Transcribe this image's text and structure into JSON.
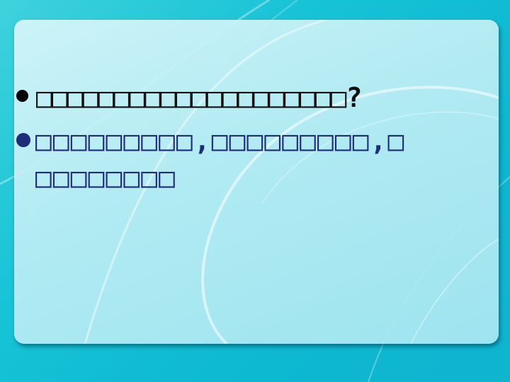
{
  "slide": {
    "bullets": [
      {
        "lines": [
          "□□□□□□□□□□□□□□□□□□□□?"
        ]
      },
      {
        "lines": [
          "   □□□□□□□□□,□□□□□□□□□,□",
          "□□□□□□□□"
        ]
      }
    ]
  },
  "colors": {
    "background": "#17c3d6",
    "panel": "#c6eff5",
    "bullet1_text": "#101010",
    "bullet2_text": "#1f2c7a"
  }
}
